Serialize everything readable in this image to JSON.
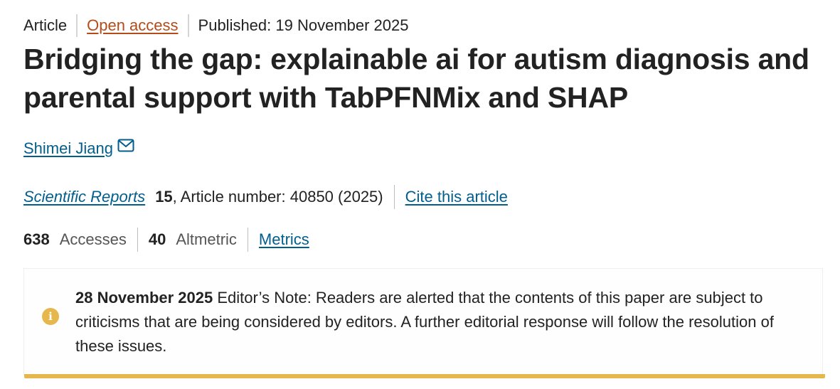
{
  "article_meta": {
    "type": "Article",
    "access": "Open access",
    "published": "Published: 19 November 2025"
  },
  "title": "Bridging the gap: explainable ai for autism diagnosis and parental support with TabPFNMix and SHAP",
  "author": {
    "name": "Shimei Jiang",
    "icon": "mail-icon"
  },
  "journal": {
    "name": "Scientific Reports",
    "volume": "15",
    "article_info": ", Article number: 40850 (2025)",
    "cite_label": "Cite this article"
  },
  "metrics": {
    "accesses_count": "638",
    "accesses_label": "Accesses",
    "altmetric_count": "40",
    "altmetric_label": "Altmetric",
    "metrics_link": "Metrics"
  },
  "notice": {
    "icon": "info-icon",
    "date": "28 November 2025",
    "text": " Editor’s Note: Readers are alerted that the contents of this paper are subject to criticisms that are being considered by editors. A further editorial response will follow the resolution of these issues.",
    "accent_color": "#e6b74c"
  },
  "colors": {
    "link": "#025e8d",
    "open_access": "#b44c1a",
    "text": "#222222"
  }
}
